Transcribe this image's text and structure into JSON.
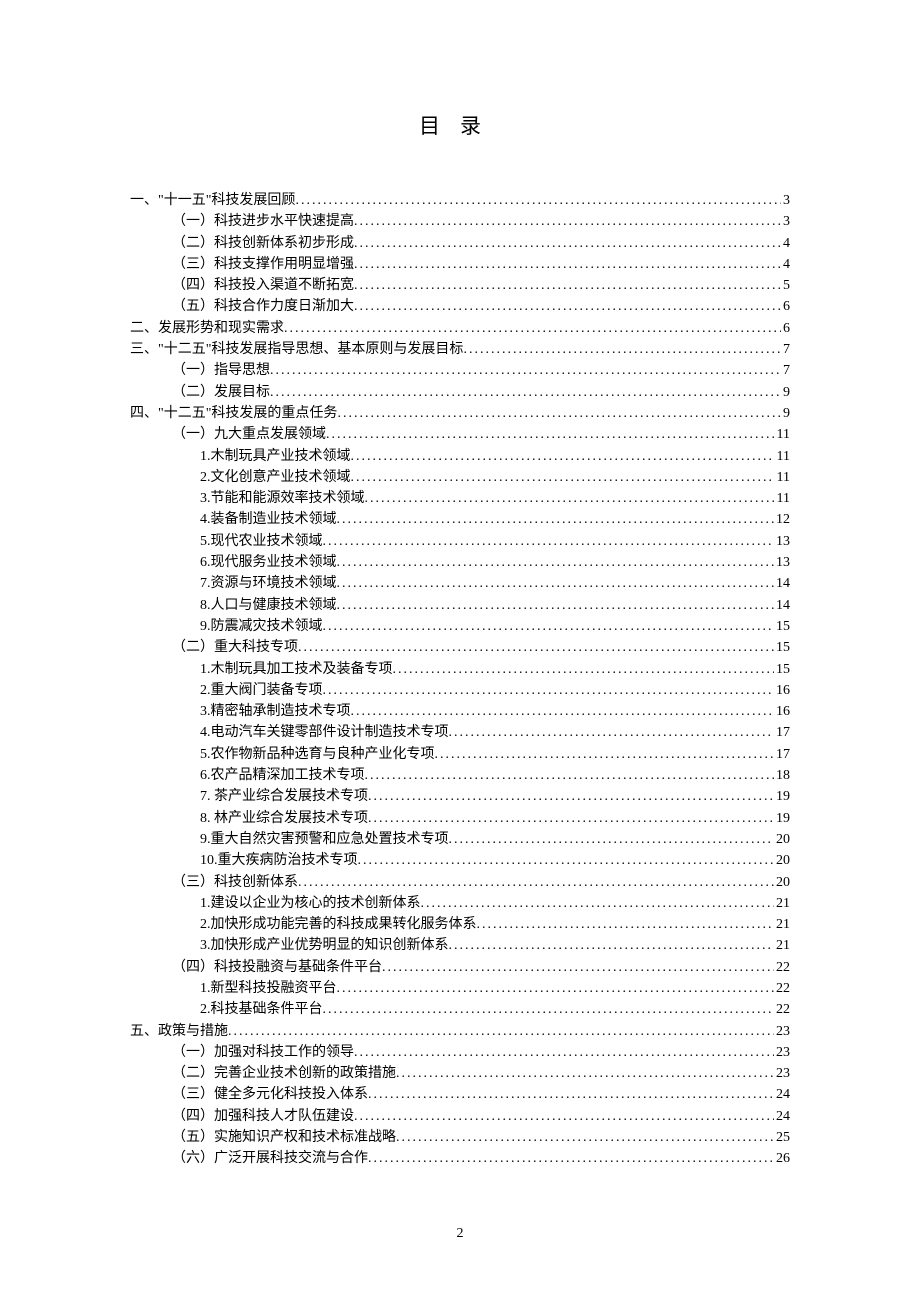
{
  "title": "目录",
  "page_number": "2",
  "toc": [
    {
      "indent": 0,
      "label": "一、\"十一五\"科技发展回顾",
      "page": "3"
    },
    {
      "indent": 1,
      "label": "（一）科技进步水平快速提高",
      "page": "3"
    },
    {
      "indent": 1,
      "label": "（二）科技创新体系初步形成",
      "page": "4"
    },
    {
      "indent": 1,
      "label": "（三）科技支撑作用明显增强",
      "page": "4"
    },
    {
      "indent": 1,
      "label": "（四）科技投入渠道不断拓宽",
      "page": "5"
    },
    {
      "indent": 1,
      "label": "（五）科技合作力度日渐加大",
      "page": "6"
    },
    {
      "indent": 0,
      "label": "二、发展形势和现实需求",
      "page": "6"
    },
    {
      "indent": 0,
      "label": "三、\"十二五\"科技发展指导思想、基本原则与发展目标",
      "page": "7"
    },
    {
      "indent": 1,
      "label": "（一）指导思想",
      "page": "7"
    },
    {
      "indent": 1,
      "label": "（二）发展目标",
      "page": "9"
    },
    {
      "indent": 0,
      "label": "四、\"十二五\"科技发展的重点任务",
      "page": "9"
    },
    {
      "indent": 1,
      "label": "（一）九大重点发展领域",
      "page": "11"
    },
    {
      "indent": 2,
      "label": "1.木制玩具产业技术领域",
      "page": "11"
    },
    {
      "indent": 2,
      "label": "2.文化创意产业技术领域",
      "page": "11"
    },
    {
      "indent": 2,
      "label": "3.节能和能源效率技术领域",
      "page": "11"
    },
    {
      "indent": 2,
      "label": "4.装备制造业技术领域",
      "page": "12"
    },
    {
      "indent": 2,
      "label": "5.现代农业技术领域",
      "page": "13"
    },
    {
      "indent": 2,
      "label": "6.现代服务业技术领域",
      "page": "13"
    },
    {
      "indent": 2,
      "label": "7.资源与环境技术领域",
      "page": "14"
    },
    {
      "indent": 2,
      "label": "8.人口与健康技术领域",
      "page": "14"
    },
    {
      "indent": 2,
      "label": "9.防震减灾技术领域",
      "page": "15"
    },
    {
      "indent": 1,
      "label": "（二）重大科技专项",
      "page": "15"
    },
    {
      "indent": 2,
      "label": "1.木制玩具加工技术及装备专项",
      "page": "15"
    },
    {
      "indent": 2,
      "label": "2.重大阀门装备专项",
      "page": "16"
    },
    {
      "indent": 2,
      "label": "3.精密轴承制造技术专项",
      "page": "16"
    },
    {
      "indent": 2,
      "label": "4.电动汽车关键零部件设计制造技术专项",
      "page": "17"
    },
    {
      "indent": 2,
      "label": "5.农作物新品种选育与良种产业化专项",
      "page": "17"
    },
    {
      "indent": 2,
      "label": "6.农产品精深加工技术专项",
      "page": "18"
    },
    {
      "indent": 2,
      "label": "7. 茶产业综合发展技术专项",
      "page": "19"
    },
    {
      "indent": 2,
      "label": "8. 林产业综合发展技术专项",
      "page": "19"
    },
    {
      "indent": 2,
      "label": "9.重大自然灾害预警和应急处置技术专项",
      "page": "20"
    },
    {
      "indent": 2,
      "label": "10.重大疾病防治技术专项",
      "page": "20"
    },
    {
      "indent": 1,
      "label": "（三）科技创新体系",
      "page": "20"
    },
    {
      "indent": 2,
      "label": "1.建设以企业为核心的技术创新体系",
      "page": "21"
    },
    {
      "indent": 2,
      "label": "2.加快形成功能完善的科技成果转化服务体系",
      "page": "21"
    },
    {
      "indent": 2,
      "label": "3.加快形成产业优势明显的知识创新体系",
      "page": "21"
    },
    {
      "indent": 1,
      "label": "（四）科技投融资与基础条件平台",
      "page": "22"
    },
    {
      "indent": 2,
      "label": "1.新型科技投融资平台",
      "page": "22"
    },
    {
      "indent": 2,
      "label": "2.科技基础条件平台",
      "page": "22"
    },
    {
      "indent": 0,
      "label": "五、政策与措施",
      "page": "23"
    },
    {
      "indent": 1,
      "label": "（一）加强对科技工作的领导",
      "page": "23"
    },
    {
      "indent": 1,
      "label": "（二）完善企业技术创新的政策措施",
      "page": "23"
    },
    {
      "indent": 1,
      "label": "（三）健全多元化科技投入体系",
      "page": "24"
    },
    {
      "indent": 1,
      "label": "（四）加强科技人才队伍建设",
      "page": "24"
    },
    {
      "indent": 1,
      "label": "（五）实施知识产权和技术标准战略",
      "page": "25"
    },
    {
      "indent": 1,
      "label": "（六）广泛开展科技交流与合作",
      "page": "26"
    }
  ]
}
